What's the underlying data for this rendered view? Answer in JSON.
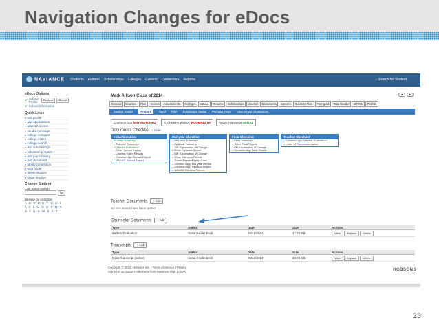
{
  "slide": {
    "title": "Navigation Changes for eDocs",
    "page_number": "23"
  },
  "app": {
    "logo": "NAVIANCE",
    "nav_items": [
      "Students",
      "Planner",
      "Scholarships",
      "Colleges",
      "Careers",
      "Connectors",
      "Reports"
    ],
    "search_label": "Search for Student"
  },
  "sidebar": {
    "edocs_options": "eDocs Options",
    "school_profile": "School Profile",
    "school_information": "School Information",
    "replace_label": "Replace",
    "delete_label": "Delete",
    "quick_links": "Quick Links",
    "links": [
      "edit profile",
      "add applications",
      "add/edit scores",
      "send a message",
      "college compare",
      "college match",
      "college search",
      "add scholarships",
      "scholarship match",
      "add journal entry",
      "add document",
      "family connection",
      "print folder",
      "delete student",
      "make inactive"
    ],
    "change_student": "Change Student",
    "last_name_search": "Last name search",
    "go_label": "Go",
    "browse_alpha": "Browse by Alphabet",
    "alphabet_rows": [
      "A B C D E F G H I",
      "J K L M N O P Q R",
      "S T U V W X Y Z"
    ]
  },
  "main": {
    "student_name": "Mark Allison Class of 2014",
    "tabs": [
      "General",
      "Courses",
      "Plan",
      "Scores",
      "Assessments",
      "Colleges",
      "eDocs",
      "Resume",
      "Scholarships",
      "Journal",
      "Documents",
      "Careers",
      "Success Plan",
      "Post-grad",
      "Total Reader",
      "eDVOL",
      "ProfMe"
    ],
    "subtabs": [
      "Student Details",
      "Prepare",
      "Send",
      "Print",
      "Submission Status",
      "Previous Years",
      "View eDocs Destinations"
    ],
    "status_1_prefix": "Common App",
    "status_1_value": "NOT MATCHED",
    "status_2_prefix": "CA FERPA Waiver",
    "status_2_value": "INCOMPLETE",
    "status_3_prefix": "Active Transcript",
    "status_3_value": "INITIAL",
    "documents_checklist": "Documents Checklist",
    "hide_label": "Hide",
    "checklists": [
      {
        "title": "Initial Checklist",
        "items": [
          {
            "text": "Initial Transcript",
            "done": true
          },
          {
            "text": "Transfer Transcript",
            "done": false
          },
          {
            "text": "Written Evaluation",
            "done": true
          },
          {
            "text": "Other School Report",
            "done": false
          },
          {
            "text": "Leaving Exam Results",
            "done": false
          },
          {
            "text": "Common App School Report",
            "done": false
          },
          {
            "text": "NACAC School Report",
            "done": false
          }
        ]
      },
      {
        "title": "Mid-year Checklist",
        "items": [
          {
            "text": "Mid-year Transcript",
            "done": false
          },
          {
            "text": "Optional Transcript",
            "done": false
          },
          {
            "text": "OR Explanation of Change",
            "done": false
          },
          {
            "text": "Other Optional Report",
            "done": false
          },
          {
            "text": "MR Explanation of Change",
            "done": false
          },
          {
            "text": "Other Mid-year Report",
            "done": false
          },
          {
            "text": "Grade Report/Report Card",
            "done": false
          },
          {
            "text": "Common App Mid-year Report",
            "done": false
          },
          {
            "text": "Common App Optional Report",
            "done": false
          },
          {
            "text": "NACAC Mid-year Report",
            "done": false
          }
        ]
      },
      {
        "title": "Final Checklist",
        "items": [
          {
            "text": "Final Transcript",
            "done": false
          },
          {
            "text": "Other Final Report",
            "done": false
          },
          {
            "text": "FR Explanation of Change",
            "done": false
          },
          {
            "text": "Common App Final Report",
            "done": false
          }
        ]
      },
      {
        "title": "Teacher Checklist",
        "items": [
          {
            "text": "Common App Teacher Evaluation",
            "done": false
          },
          {
            "text": "Letter of Recommendation",
            "done": false
          }
        ]
      }
    ],
    "teacher_documents": "Teacher Documents",
    "add_label": "Add",
    "no_documents": "No documents have been added.",
    "counselor_documents": "Counselor Documents",
    "transcripts": "Transcripts",
    "table_headers": [
      "Type",
      "Author",
      "Date",
      "Size",
      "Actions"
    ],
    "counselor_rows": [
      [
        "Written Evaluation",
        "Susan Hallenbeck",
        "06/18/2014",
        "17.73 KB"
      ]
    ],
    "transcript_rows": [
      [
        "Initial Transcript (active)",
        "Susan Hallenbeck",
        "06/18/2014",
        "20.76 KB"
      ]
    ],
    "actions": [
      "View",
      "Replace",
      "Delete"
    ],
    "footer_line1": "Copyright © 2014, Hobsons Inc. | Terms of Service | Privacy",
    "footer_line2": "Signed in as Susan Hallenbeck from Naviance High School",
    "brand": "HOBSONS"
  },
  "colors": {
    "nav_blue": "#2f5d8c",
    "tab_blue": "#3a7cbf",
    "alert_red": "#d20000",
    "ok_green": "#1f8f2f"
  }
}
